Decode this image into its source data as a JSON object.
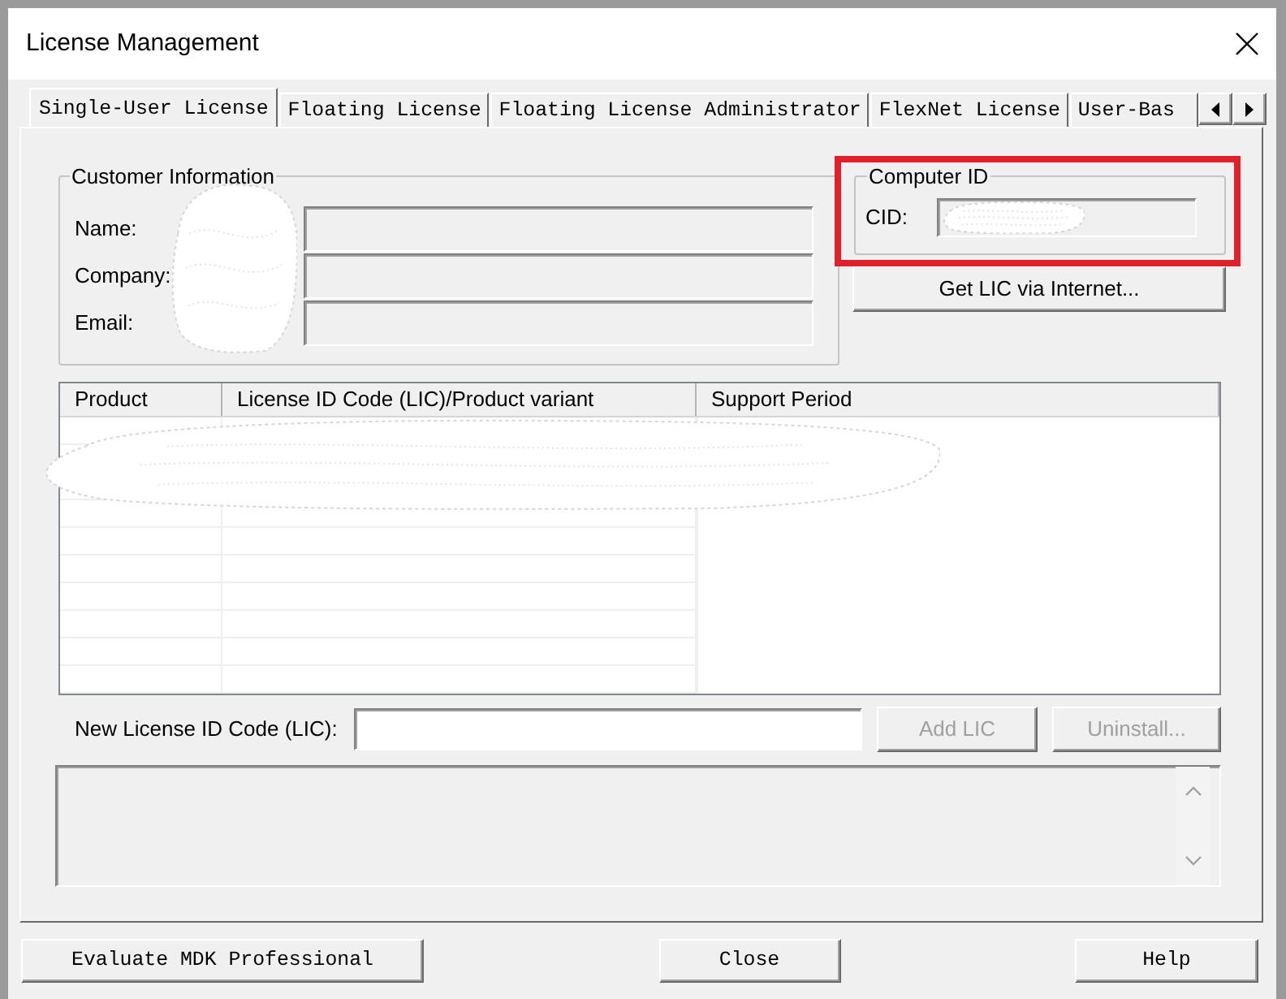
{
  "window": {
    "title": "License Management"
  },
  "tabs": [
    {
      "label": "Single-User License",
      "selected": true
    },
    {
      "label": "Floating License",
      "selected": false
    },
    {
      "label": "Floating License Administrator",
      "selected": false
    },
    {
      "label": "FlexNet License",
      "selected": false
    },
    {
      "label": "User-Bas",
      "selected": false
    }
  ],
  "customer_information": {
    "title": "Customer Information",
    "redacted": true,
    "fields": [
      {
        "label": "Name:"
      },
      {
        "label": "Company:"
      },
      {
        "label": "Email:"
      }
    ]
  },
  "computer_id": {
    "title": "Computer ID",
    "highlighted": true,
    "fields": [
      {
        "label": "CID:",
        "redacted": true
      }
    ]
  },
  "get_lic_button": {
    "label": "Get LIC via Internet..."
  },
  "table": {
    "columns": [
      "Product",
      "License ID Code (LIC)/Product variant",
      "Support Period"
    ],
    "redacted": true
  },
  "new_license": {
    "label": "New License ID Code (LIC):"
  },
  "actions": [
    {
      "label": "Add LIC",
      "disabled": true
    },
    {
      "label": "Uninstall...",
      "disabled": true
    }
  ],
  "footer_buttons": [
    {
      "label": "Evaluate MDK Professional"
    },
    {
      "label": "Close"
    },
    {
      "label": "Help"
    }
  ]
}
